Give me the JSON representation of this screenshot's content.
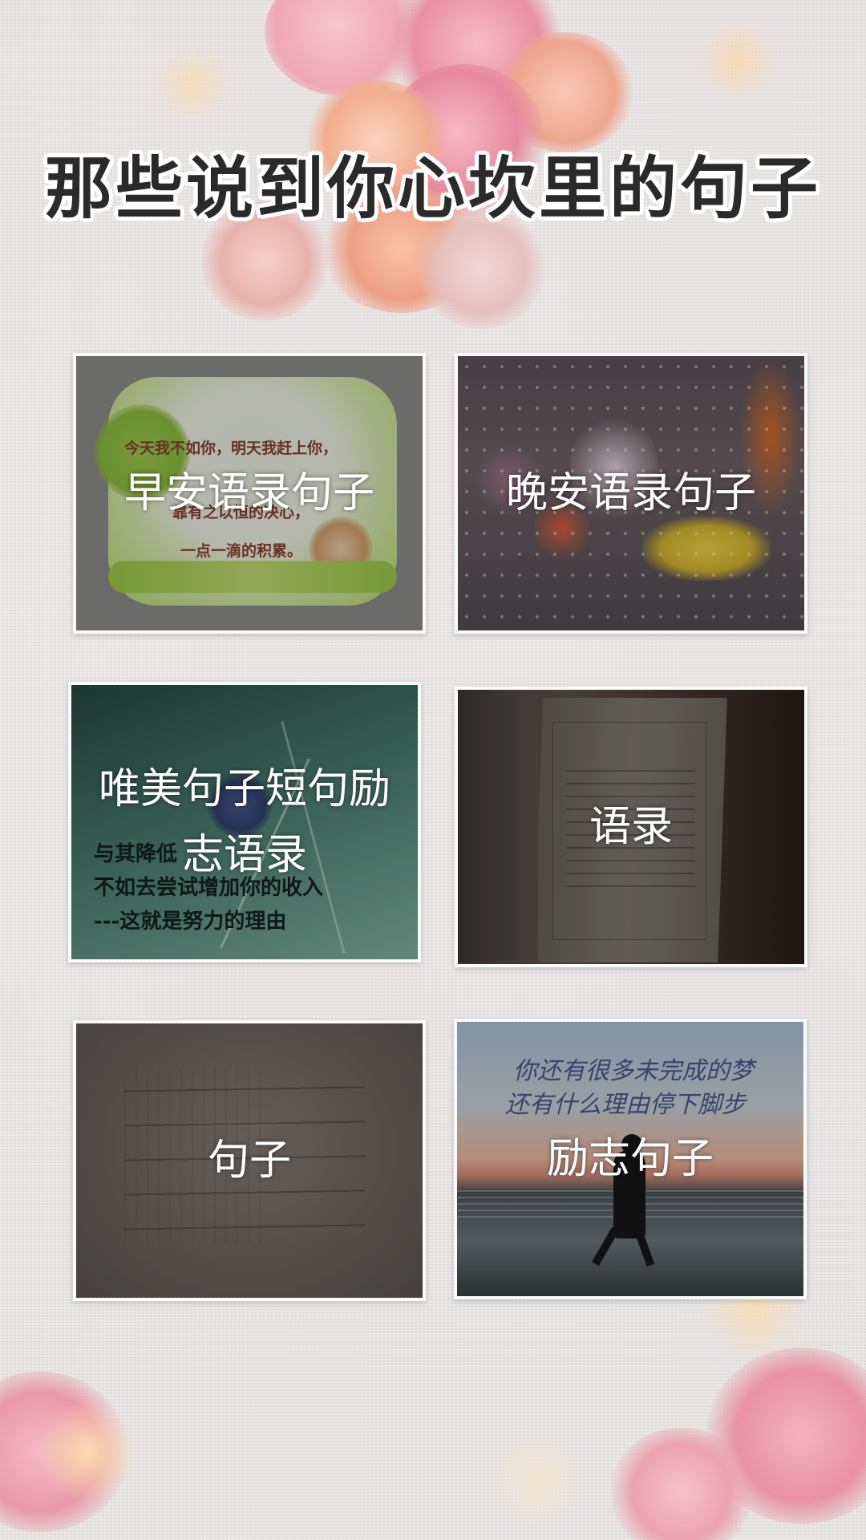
{
  "page": {
    "title": "那些说到你心坎里的句子"
  },
  "categories": [
    {
      "label": "早安语录句子"
    },
    {
      "label": "晚安语录句子"
    },
    {
      "label": "唯美句子短句励志语录"
    },
    {
      "label": "语录"
    },
    {
      "label": "句子"
    },
    {
      "label": "励志句子"
    }
  ],
  "thumbnails": {
    "card1_lines": [
      "今天我不如你，明天我赶上你，",
      "靠有之以恒的决心，",
      "一点一滴的积累。"
    ],
    "card3_lines": [
      "与其降低",
      "不如去尝试增加你的收入",
      "---这就是努力的理由"
    ],
    "card6_lines": [
      "你还有很多未完成的梦",
      "还有什么理由停下脚步"
    ]
  },
  "colors": {
    "title_text": "#2a2a2a",
    "title_outline": "#ffffff",
    "card_border": "#fafafa",
    "label_text": "#ffffff"
  }
}
